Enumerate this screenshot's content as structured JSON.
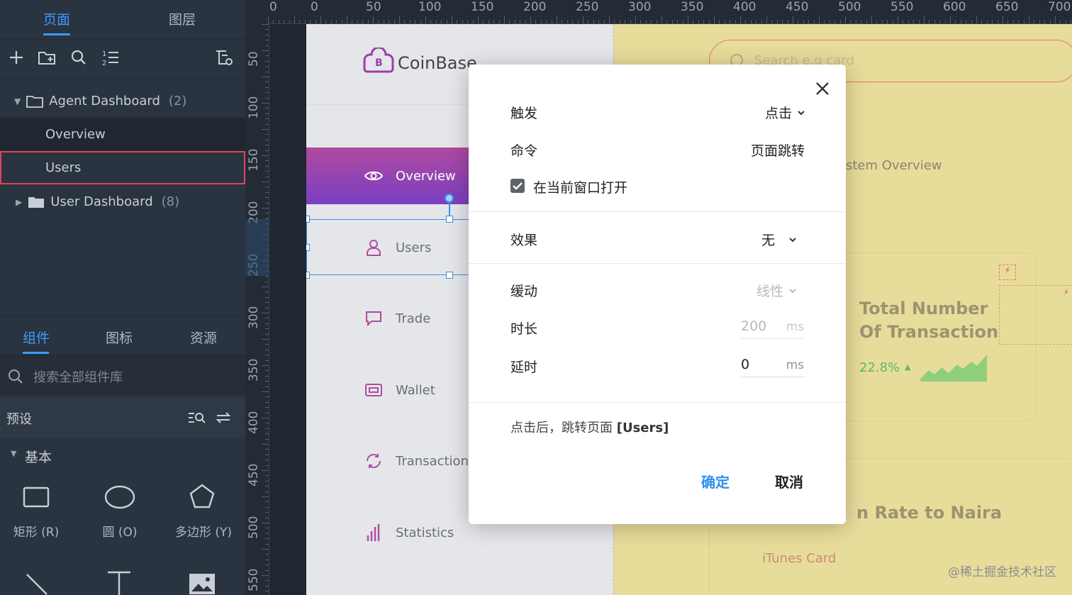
{
  "left_panel": {
    "tabs": [
      "页面",
      "图层"
    ],
    "tree": {
      "folder1": "Agent Dashboard",
      "folder1_count": "(2)",
      "page1": "Overview",
      "page2": "Users",
      "folder2": "User Dashboard",
      "folder2_count": "(8)"
    },
    "bottom_tabs": [
      "组件",
      "图标",
      "资源"
    ],
    "search_placeholder": "搜索全部组件库",
    "preset_label": "预设",
    "section_label": "基本",
    "components": [
      "矩形 (R)",
      "圆 (O)",
      "多边形 (Y)"
    ]
  },
  "ruler": {
    "top_ticks": [
      "0",
      "0",
      "50",
      "100",
      "150",
      "200",
      "250",
      "300",
      "350",
      "400",
      "450",
      "500",
      "550",
      "600",
      "650",
      "700"
    ],
    "left_ticks": [
      "50",
      "100",
      "150",
      "200",
      "250",
      "300",
      "350",
      "400",
      "450",
      "500",
      "550"
    ]
  },
  "design": {
    "logo_text": "CoinBase",
    "search_placeholder": "Search e.g card",
    "nav": [
      "Overview",
      "Users",
      "Trade",
      "Wallet",
      "Transactions",
      "Statistics"
    ],
    "section_title": "stem Overview",
    "card_title_1": "Total Number",
    "card_title_2": "Of Transaction",
    "card_percent": "22.8%",
    "rate_title": "n Rate to Naira",
    "itunes": "iTunes Card"
  },
  "dialog": {
    "trigger_label": "触发",
    "trigger_value": "点击",
    "command_label": "命令",
    "command_value": "页面跳转",
    "open_current_label": "在当前窗口打开",
    "open_current_checked": true,
    "effect_label": "效果",
    "effect_value": "无",
    "easing_label": "缓动",
    "easing_value": "线性",
    "duration_label": "时长",
    "duration_value": "200",
    "duration_unit": "ms",
    "delay_label": "延时",
    "delay_value": "0",
    "delay_unit": "ms",
    "summary_prefix": "点击后，跳转页面",
    "summary_target": "[Users]",
    "confirm": "确定",
    "cancel": "取消"
  },
  "watermark": "@稀土掘金技术社区",
  "colors": {
    "accent": "#3b9cff",
    "selection": "#e0435c",
    "nav_active_start": "#b04aa0",
    "nav_active_end": "#7a3fc2",
    "green": "#3db36b"
  }
}
